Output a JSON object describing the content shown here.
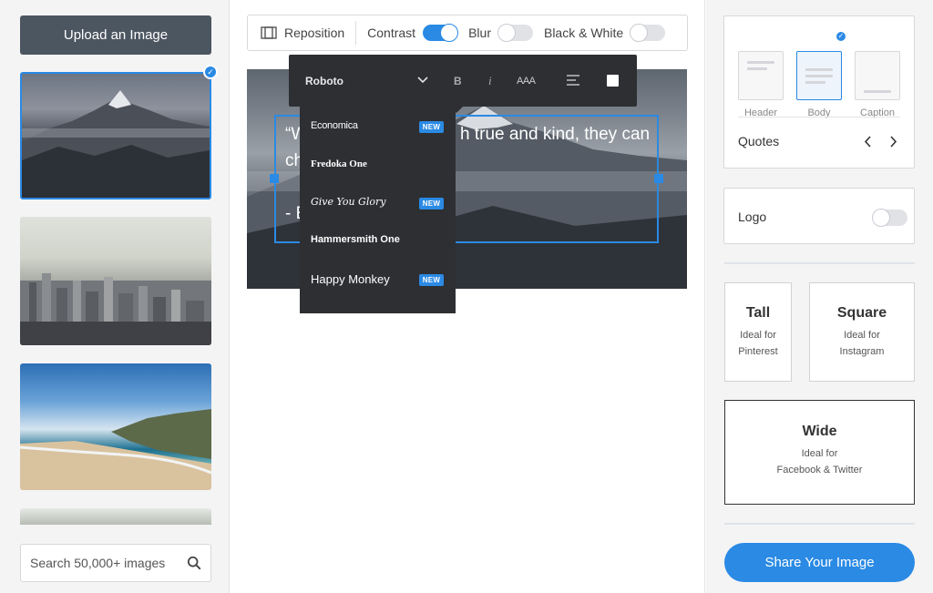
{
  "left_panel": {
    "upload_label": "Upload an Image",
    "search_placeholder": "Search 50,000+ images",
    "selected_index": 0
  },
  "toolbar": {
    "reposition_label": "Reposition",
    "contrast_label": "Contrast",
    "contrast_on": true,
    "blur_label": "Blur",
    "blur_on": false,
    "bw_label": "Black & White",
    "bw_on": false
  },
  "canvas": {
    "quote_line1_left": "“W",
    "quote_line1_right": "h true and kind, they can",
    "quote_line2": "ch",
    "quote_line3": "- E"
  },
  "font_toolbar": {
    "current_font": "Roboto",
    "bold_label": "B",
    "italic_label": "i",
    "size_label": "AAA"
  },
  "font_list": {
    "items": [
      {
        "name": "Economica",
        "is_new": true
      },
      {
        "name": "Fredoka One",
        "is_new": false
      },
      {
        "name": "Give You Glory",
        "is_new": true
      },
      {
        "name": "Hammersmith One",
        "is_new": false
      },
      {
        "name": "Happy Monkey",
        "is_new": true
      }
    ],
    "new_label": "NEW"
  },
  "right_panel": {
    "text_styles": [
      {
        "label": "Header",
        "selected": false
      },
      {
        "label": "Body",
        "selected": true
      },
      {
        "label": "Caption",
        "selected": false
      }
    ],
    "quotes_label": "Quotes",
    "logo_label": "Logo",
    "logo_on": false,
    "sizes": {
      "tall_title": "Tall",
      "tall_sub1": "Ideal for",
      "tall_sub2": "Pinterest",
      "square_title": "Square",
      "square_sub1": "Ideal for",
      "square_sub2": "Instagram",
      "wide_title": "Wide",
      "wide_sub1": "Ideal for",
      "wide_sub2": "Facebook & Twitter",
      "selected": "Wide"
    },
    "share_label": "Share Your Image"
  },
  "colors": {
    "accent": "#2a8ae4",
    "upload_button": "#4c5661",
    "dropdown_bg": "#2e2f33"
  }
}
